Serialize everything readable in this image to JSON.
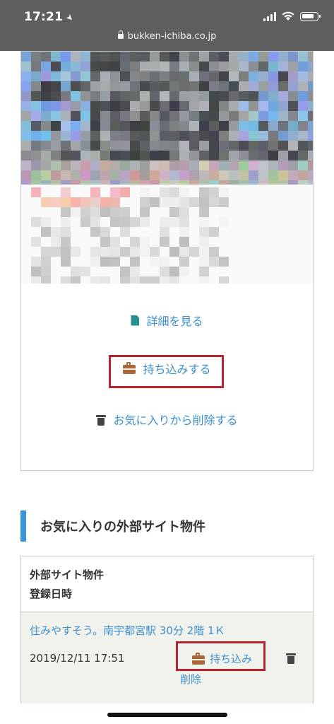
{
  "status_bar": {
    "time": "17:21",
    "url": "bukken-ichiba.co.jp"
  },
  "favorite_card": {
    "actions": {
      "detail": "詳細を見る",
      "bring_in": "持ち込みする",
      "remove_favorite": "お気に入りから削除する"
    }
  },
  "external_section": {
    "heading": "お気に入りの外部サイト物件",
    "table": {
      "headers": [
        "外部サイト物件",
        "登録日時"
      ],
      "rows": [
        {
          "title": "住みやすそう。南宇都宮駅 30分 2階 1Ｋ",
          "date": "2019/12/11 17:51",
          "bring_in": "持ち込み",
          "delete": "削除"
        }
      ]
    }
  },
  "colors": {
    "link": "#3b8fd0",
    "highlight": "#b32630",
    "section_accent": "#3a96db",
    "bag_icon": "#a8683a",
    "doc_icon": "#2a8f8f"
  }
}
